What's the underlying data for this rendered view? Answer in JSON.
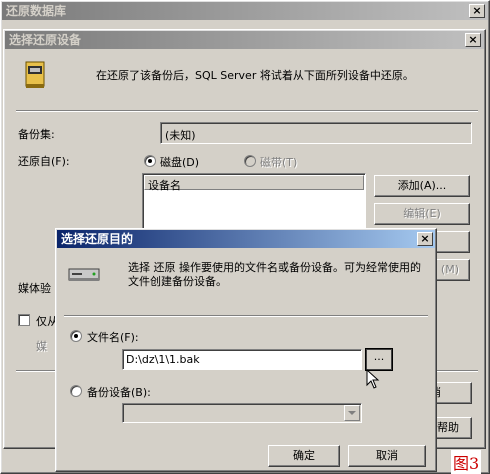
{
  "bg_window": {
    "title": "还原数据库"
  },
  "device_dialog": {
    "title": "选择还原设备",
    "info_text": "在还原了该备份后，SQL Server 将试着从下面所列设备中还原。",
    "backup_set_label": "备份集:",
    "backup_set_value": "(未知)",
    "restore_from_label": "还原自(F):",
    "radio_disk": "磁盘(D)",
    "radio_tape": "磁带(T)",
    "list_header": "设备名",
    "btn_add": "添加(A)...",
    "btn_edit": "编辑(E)",
    "btn_hidden3": "(M)",
    "media_label": "媒体验",
    "only_label": "仅从",
    "media_sub": "媒",
    "btn_cancel_partial": "消",
    "btn_help_partial": "帮助"
  },
  "dest_dialog": {
    "title": "选择还原目的",
    "info_text": "选择 还原 操作要使用的文件名或备份设备。可为经常使用的文件创建备份设备。",
    "radio_filename": "文件名(F):",
    "filename_value": "D:\\dz\\1\\1.bak",
    "browse_label": "...",
    "radio_backup_device": "备份设备(B):",
    "btn_ok": "确定",
    "btn_cancel": "取消"
  },
  "figure_label": "图3",
  "colors": {
    "titlebar_active": "#0a246a",
    "titlebar_gradient_end": "#a6caf0",
    "face": "#d4d0c8",
    "figure_label": "#cc0000"
  }
}
